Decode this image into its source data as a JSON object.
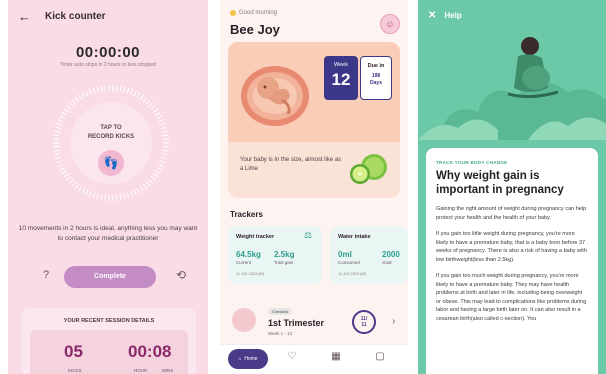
{
  "kick_counter": {
    "title": "Kick counter",
    "timer": "00:00:00",
    "timer_note": "Timer auto stops in 2 hours or less stopped",
    "dial_label_line1": "TAP TO",
    "dial_label_line2": "RECORD KICKS",
    "movement_note": "10 movements in 2 hours is ideal, anything less you may want to contact your medical practitioner",
    "help_symbol": "?",
    "complete_label": "Complete",
    "reset_symbol": "⟲",
    "recent_title": "YOUR RECENT SESSION DETAILS",
    "kicks_value": "05",
    "kicks_label": "KICKS",
    "time_value": "00:08",
    "hour_label": "HOUR",
    "mins_label": "MINS",
    "colors": {
      "background": "#f9dce6",
      "accent": "#c48cc4",
      "stat": "#8a2a6a"
    }
  },
  "home": {
    "greeting": "Good morning",
    "user_name": "Bee Joy",
    "week_label": "Week",
    "week_number": "12",
    "due_label": "Due in",
    "due_days_line1": "198",
    "due_days_line2": "Days",
    "size_text": "Your baby is in the size, almost like as a Lime",
    "trackers_title": "Trackers",
    "weight": {
      "title": "Weight tracker",
      "current_value": "64.5kg",
      "current_label": "Current",
      "gain_value": "2.5kg",
      "gain_label": "Total gain",
      "date": "11 JUL 2023 (W)"
    },
    "water": {
      "title": "Water intake",
      "consumed_value": "0ml",
      "consumed_label": "Consumed",
      "goal_value": "2000",
      "goal_label": "Goal",
      "date": "11 JUL 2023 (W)"
    },
    "trimester": {
      "badge": "Checklist",
      "title": "1st Trimester",
      "weeks": "Week 1 - 13",
      "progress_line1": "11/",
      "progress_line2": "11"
    },
    "nav": {
      "home_label": "Home"
    },
    "colors": {
      "hero": "#f9cdb8",
      "week_card": "#3c3789",
      "tracker_value": "#2e9e8c"
    }
  },
  "help": {
    "title": "Help",
    "close_symbol": "✕",
    "kicker": "TRACK YOUR BODY CHANGE",
    "article_title": "Why weight gain is important in pregnancy",
    "paragraph_1": "Gaining the right amount of weight during pregnancy can help protect your health and the health of your baby.",
    "paragraph_2": "If you gain too little weight during pregnancy, you're more likely to have a premature baby, that is a baby born before 37 weeks of pregnancy. There is also a risk of having a baby with low birthweight(less than 2.5kg).",
    "paragraph_3": "If you gain too much weight during pregnancy, you're more likely to have a premature baby. They may have health problems at birth and later in life, including being overweight or obese. This may lead to complications like problems during labor and having a large birth later on. It can also result in a cesarean birth(also called c-section). You",
    "colors": {
      "background": "#6cc9a8",
      "kicker": "#3aa68b"
    }
  }
}
